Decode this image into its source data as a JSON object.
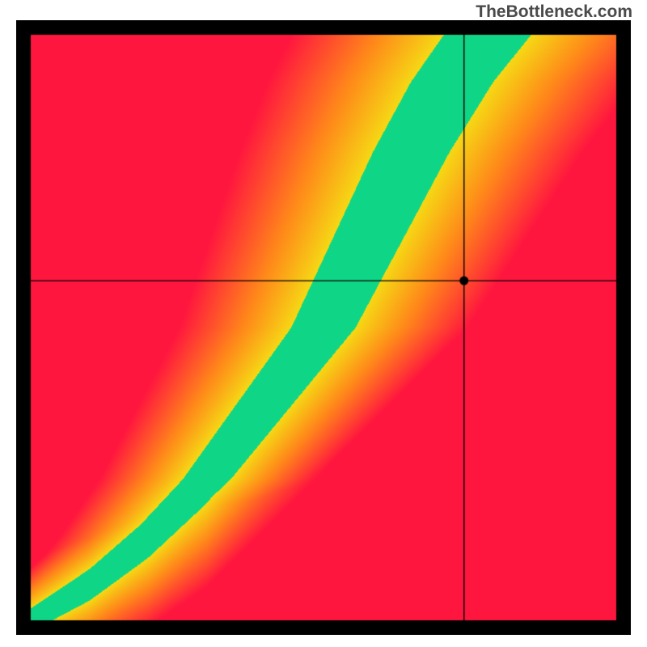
{
  "watermark": "TheBottleneck.com",
  "chart_data": {
    "type": "heatmap",
    "description": "Bottleneck calculator heatmap with crosshair marker. Color encodes fit quality (green = optimal curve, yellow = near-optimal, red = bottleneck). A superlinear green optimal band runs from lower-left to upper-right.",
    "x_range": [
      0,
      100
    ],
    "y_range": [
      0,
      100
    ],
    "crosshair": {
      "x": 74,
      "y": 58
    },
    "marker": {
      "x": 74,
      "y": 58
    },
    "color_stops": [
      {
        "label": "severe-bottleneck",
        "color": "#ff1a3a"
      },
      {
        "label": "bottleneck",
        "color": "#ff7a1e"
      },
      {
        "label": "near",
        "color": "#f7e219"
      },
      {
        "label": "optimal",
        "color": "#11d487"
      }
    ],
    "optimal_curve_points": [
      {
        "x": 0,
        "y": 0
      },
      {
        "x": 10,
        "y": 6
      },
      {
        "x": 20,
        "y": 14
      },
      {
        "x": 30,
        "y": 24
      },
      {
        "x": 40,
        "y": 37
      },
      {
        "x": 50,
        "y": 50
      },
      {
        "x": 55,
        "y": 60
      },
      {
        "x": 60,
        "y": 70
      },
      {
        "x": 65,
        "y": 80
      },
      {
        "x": 72,
        "y": 92
      },
      {
        "x": 78,
        "y": 100
      }
    ],
    "border_color": "#000000",
    "border_width": 18
  }
}
